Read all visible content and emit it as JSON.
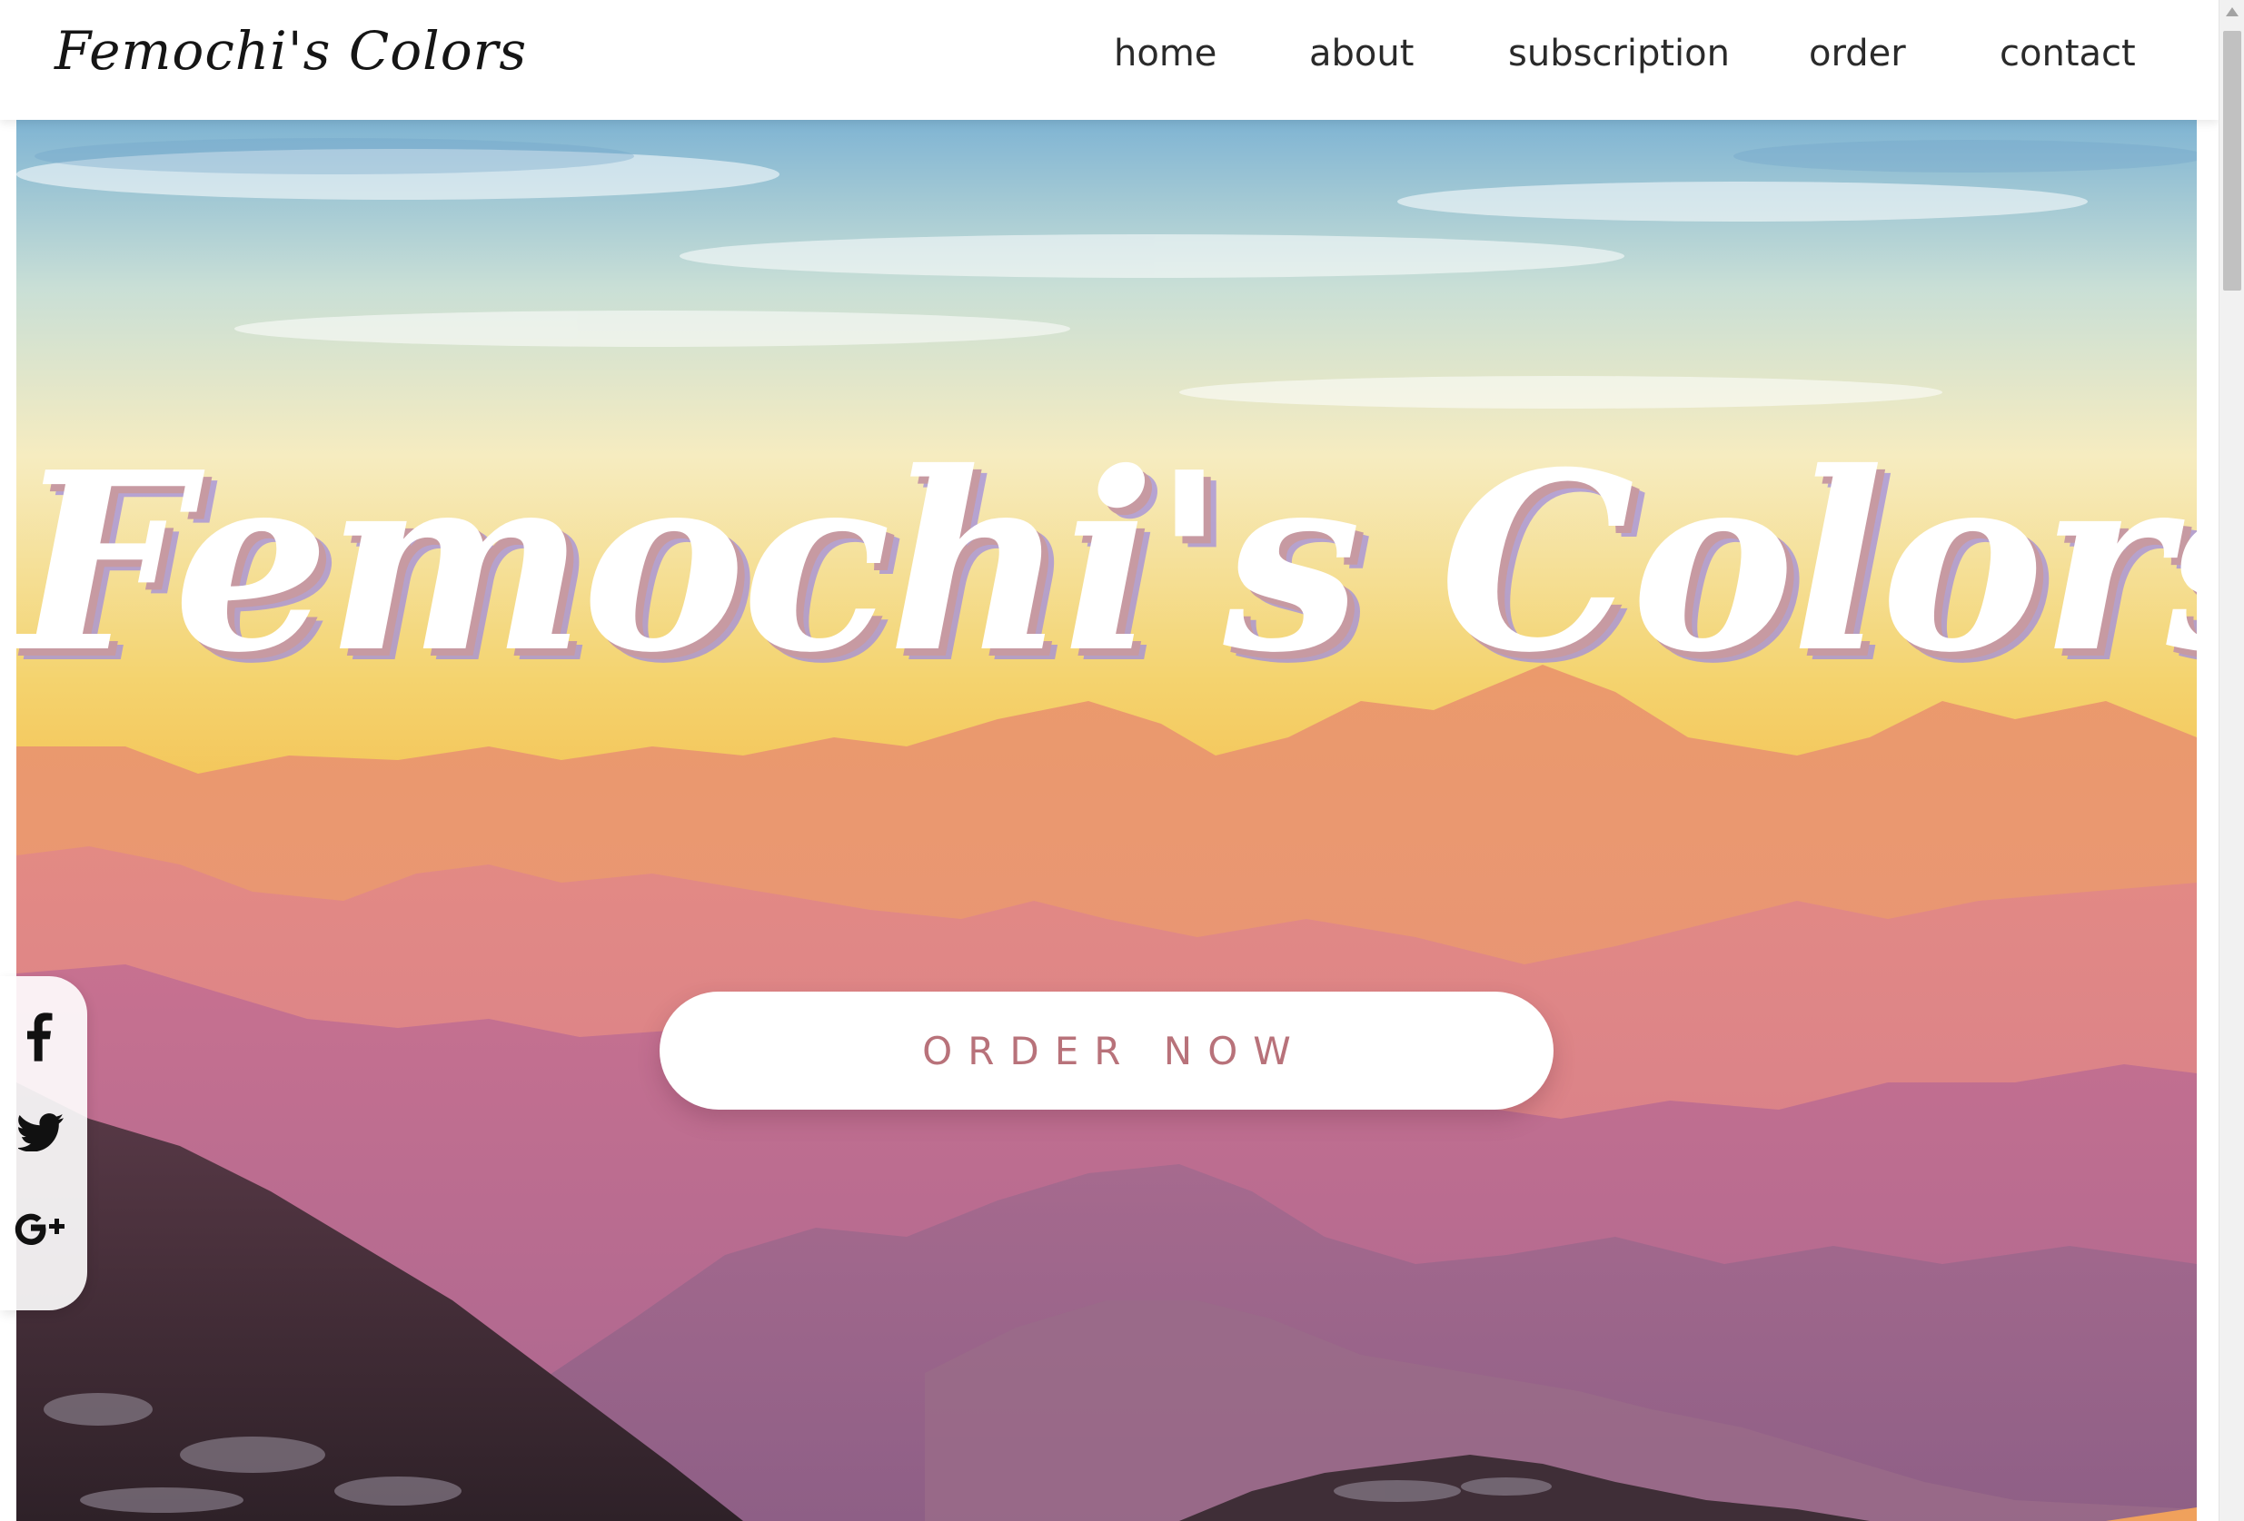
{
  "header": {
    "brand": "Femochi's Colors",
    "nav": [
      {
        "label": "home"
      },
      {
        "label": "about"
      },
      {
        "label": "subscription"
      },
      {
        "label": "order"
      },
      {
        "label": "contact"
      }
    ]
  },
  "hero": {
    "title": "Femochi's Colors",
    "cta_label": "ORDER NOW",
    "background": "mountain-sunset-photo"
  },
  "social": [
    {
      "icon": "facebook-icon"
    },
    {
      "icon": "twitter-icon"
    },
    {
      "icon": "google-plus-icon"
    }
  ],
  "colors": {
    "cta_text": "#b8727a",
    "title_shadow": "#c79aa2",
    "sky_top": "#7fb4d3",
    "sky_mid": "#f4d36e",
    "sky_horizon": "#f2b33e",
    "ridge_far": "#e8a07c",
    "ridge_mid": "#d67e86",
    "ridge_near": "#a35e86",
    "foreground": "#3e2c35"
  }
}
